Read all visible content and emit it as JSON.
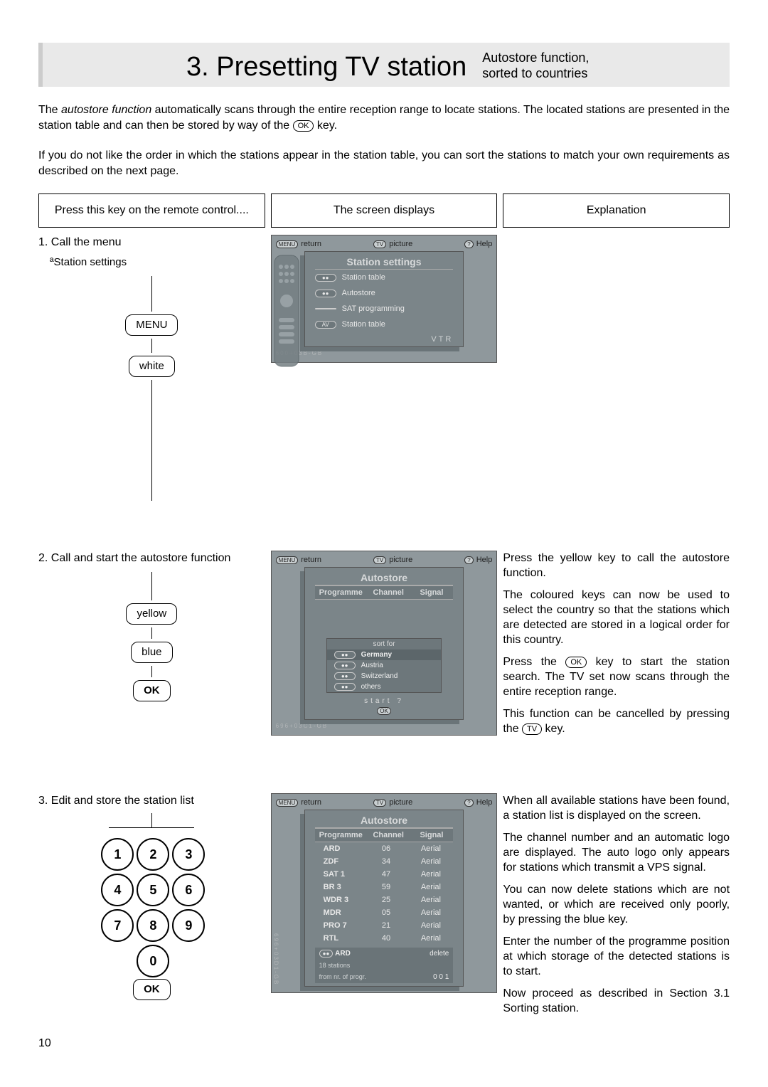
{
  "header": {
    "title": "3. Presetting TV station",
    "subtitle_line1": "Autostore function,",
    "subtitle_line2": "sorted to countries"
  },
  "intro": {
    "p1_a": "The ",
    "p1_b": "autostore function",
    "p1_c": " automatically scans through the entire reception range to locate stations. The located stations are presented in the station table and can then be stored by way of the ",
    "p1_key": "OK",
    "p1_d": " key.",
    "p2": "If you do not like the order in which the stations appear in the station table, you can sort the stations to match your own requirements as described on the next page."
  },
  "columns": {
    "left_head": "Press this key on the remote control....",
    "mid_head": "The screen displays",
    "right_head": "Explanation"
  },
  "step1": {
    "title": "1. Call the menu",
    "sub": "ªStation settings",
    "btn_menu": "MENU",
    "btn_white": "white",
    "screen": {
      "top_return": "return",
      "top_picture": "picture",
      "top_help": "Help",
      "panel_title": "Station settings",
      "items": [
        "Station table",
        "Autostore",
        "SAT programming",
        "Station table"
      ],
      "chips": [
        "●●",
        "●●",
        "",
        "AV"
      ],
      "vtr": "VTR",
      "code": "600+03B-GB"
    }
  },
  "step2": {
    "title": "2. Call and start the autostore function",
    "btn_yellow": "yellow",
    "btn_blue": "blue",
    "btn_ok": "OK",
    "screen": {
      "top_return": "return",
      "top_picture": "picture",
      "top_help": "Help",
      "panel_title": "Autostore",
      "th1": "Programme",
      "th2": "Channel",
      "th3": "Signal",
      "sort_title": "sort for",
      "sort_items": [
        "Germany",
        "Austria",
        "Switzerland",
        "others"
      ],
      "start": "start ?",
      "ok": "OK",
      "code": "696+03C1-GB"
    },
    "explain": {
      "p1": "Press the yellow key to call the autostore function.",
      "p2": "The coloured keys can now be used to select the country so that the stations which are detected are stored in a logical order for this country.",
      "p3a": "Press the ",
      "p3key": "OK",
      "p3b": " key to start the station search. The TV set now scans through the entire reception range.",
      "p4a": "This function can be cancelled by pressing the ",
      "p4key": "TV",
      "p4b": " key."
    }
  },
  "step3": {
    "title": "3. Edit and store the station list",
    "numpad": [
      "1",
      "2",
      "3",
      "4",
      "5",
      "6",
      "7",
      "8",
      "9",
      "0"
    ],
    "btn_ok": "OK",
    "screen": {
      "top_return": "return",
      "top_picture": "picture",
      "top_help": "Help",
      "panel_title": "Autostore",
      "th1": "Programme",
      "th2": "Channel",
      "th3": "Signal",
      "rows": [
        {
          "p": "ARD",
          "c": "06",
          "s": "Aerial"
        },
        {
          "p": "ZDF",
          "c": "34",
          "s": "Aerial"
        },
        {
          "p": "SAT 1",
          "c": "47",
          "s": "Aerial"
        },
        {
          "p": "BR 3",
          "c": "59",
          "s": "Aerial"
        },
        {
          "p": "WDR 3",
          "c": "25",
          "s": "Aerial"
        },
        {
          "p": "MDR",
          "c": "05",
          "s": "Aerial"
        },
        {
          "p": "PRO 7",
          "c": "21",
          "s": "Aerial"
        },
        {
          "p": "RTL",
          "c": "40",
          "s": "Aerial"
        }
      ],
      "foot_name": "ARD",
      "foot_delete": "delete",
      "foot_count": "18 stations",
      "foot_from": "from nr. of progr.",
      "foot_nr": "0 0 1",
      "code": "696+03D1-GB"
    },
    "explain": {
      "p1": "When all available stations have been found, a station list is displayed on the screen.",
      "p2": "The channel number and an automatic logo are displayed. The auto logo only appears for stations which transmit a VPS signal.",
      "p3": "You can now delete stations which are not wanted, or which are received only poorly, by pressing the blue key.",
      "p4": "Enter the number of the programme position at which storage of the detected stations is to start.",
      "p5": "Now proceed as described in Section 3.1 Sorting station."
    }
  },
  "page_number": "10"
}
